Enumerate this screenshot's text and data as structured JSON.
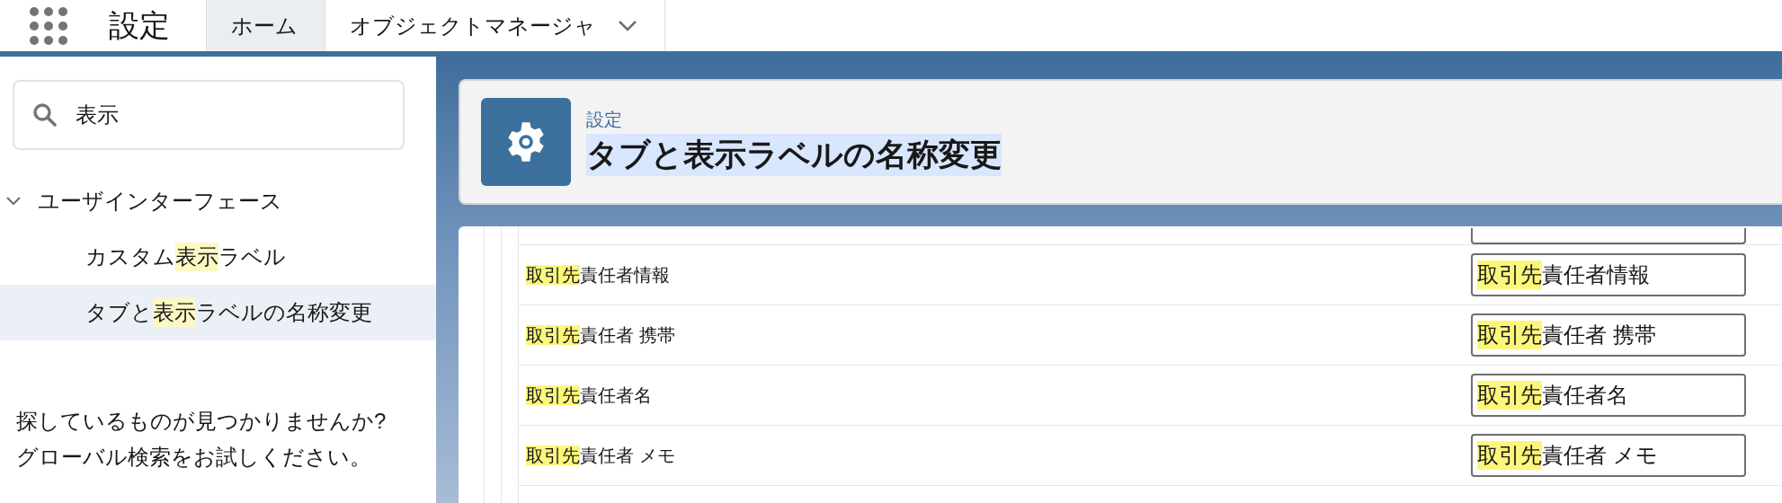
{
  "top_bar": {
    "app_title": "設定",
    "tabs": [
      {
        "label": "ホーム",
        "selected": true,
        "has_menu": false
      },
      {
        "label": "オブジェクトマネージャ",
        "selected": false,
        "has_menu": true
      }
    ]
  },
  "sidebar": {
    "search": {
      "value": "表示"
    },
    "tree": [
      {
        "label": [
          {
            "text": "ユーザインターフェース",
            "highlighted": false
          }
        ],
        "expanded": true,
        "children": [
          {
            "label": [
              {
                "text": "カスタム",
                "highlighted": false
              },
              {
                "text": "表示",
                "highlighted": true
              },
              {
                "text": "ラベル",
                "highlighted": false
              }
            ],
            "selected": false
          },
          {
            "label": [
              {
                "text": "タブと",
                "highlighted": false
              },
              {
                "text": "表示",
                "highlighted": true
              },
              {
                "text": "ラベルの名称変更",
                "highlighted": false
              }
            ],
            "selected": true
          }
        ]
      }
    ],
    "help_lines": [
      "探しているものが見つかりませんか?",
      "グローバル検索をお試しください。"
    ]
  },
  "header": {
    "breadcrumb": "設定",
    "title": "タブと表示ラベルの名称変更",
    "title_selected": true
  },
  "rows": [
    {
      "label": [
        {
          "text": "取引先",
          "highlighted": true
        },
        {
          "text": "責任者情報",
          "highlighted": false
        }
      ],
      "value": [
        {
          "text": "取引先",
          "highlighted": true
        },
        {
          "text": "責任者情報",
          "highlighted": false
        }
      ]
    },
    {
      "label": [
        {
          "text": "取引先",
          "highlighted": true
        },
        {
          "text": "責任者 携帯",
          "highlighted": false
        }
      ],
      "value": [
        {
          "text": "取引先",
          "highlighted": true
        },
        {
          "text": "責任者 携帯",
          "highlighted": false
        }
      ]
    },
    {
      "label": [
        {
          "text": "取引先",
          "highlighted": true
        },
        {
          "text": "責任者名",
          "highlighted": false
        }
      ],
      "value": [
        {
          "text": "取引先",
          "highlighted": true
        },
        {
          "text": "責任者名",
          "highlighted": false
        }
      ]
    },
    {
      "label": [
        {
          "text": "取引先",
          "highlighted": true
        },
        {
          "text": "責任者 メモ",
          "highlighted": false
        }
      ],
      "value": [
        {
          "text": "取引先",
          "highlighted": true
        },
        {
          "text": "責任者 メモ",
          "highlighted": false
        }
      ]
    }
  ]
}
